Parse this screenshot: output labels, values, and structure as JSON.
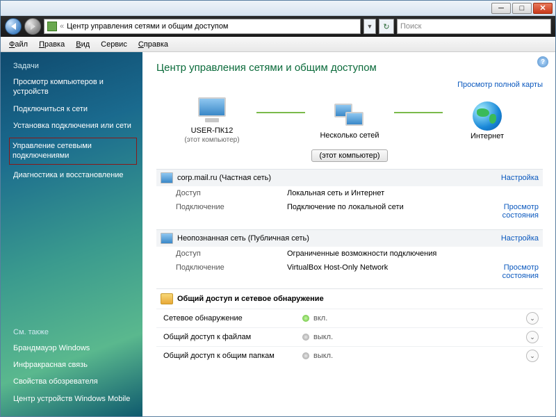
{
  "titlebar": {
    "minimize": "_",
    "maximize": "□",
    "close": "X"
  },
  "addressbar": {
    "crumb_prefix": "«",
    "crumb": "Центр управления сетями и общим доступом",
    "search_placeholder": "Поиск"
  },
  "menubar": {
    "file": "Файл",
    "edit": "Правка",
    "view": "Вид",
    "tools": "Сервис",
    "help": "Справка"
  },
  "sidebar": {
    "tasks_heading": "Задачи",
    "items": [
      "Просмотр компьютеров и устройств",
      "Подключиться к сети",
      "Установка подключения или сети",
      "Управление сетевыми подключениями",
      "Диагностика и восстановление"
    ],
    "see_also_heading": "См. также",
    "see_also": [
      "Брандмауэр Windows",
      "Инфракрасная связь",
      "Свойства обозревателя",
      "Центр устройств Windows Mobile"
    ]
  },
  "main": {
    "title": "Центр управления сетями и общим доступом",
    "full_map": "Просмотр полной карты",
    "map": {
      "pc_name": "USER-ПК12",
      "pc_sub": "(этот компьютер)",
      "multi": "Несколько сетей",
      "internet": "Интернет"
    },
    "this_computer_btn": "(этот компьютер)",
    "networks": [
      {
        "name": "corp.mail.ru (Частная сеть)",
        "customize": "Настройка",
        "access_label": "Доступ",
        "access_value": "Локальная сеть и Интернет",
        "conn_label": "Подключение",
        "conn_value": "Подключение по локальной сети",
        "view_status": "Просмотр состояния"
      },
      {
        "name": "Неопознанная сеть (Публичная сеть)",
        "customize": "Настройка",
        "access_label": "Доступ",
        "access_value": "Ограниченные возможности подключения",
        "conn_label": "Подключение",
        "conn_value": "VirtualBox Host-Only Network",
        "view_status": "Просмотр состояния"
      }
    ],
    "sharing": {
      "heading": "Общий доступ и сетевое обнаружение",
      "rows": [
        {
          "label": "Сетевое обнаружение",
          "state": "on",
          "state_text": "вкл."
        },
        {
          "label": "Общий доступ к файлам",
          "state": "off",
          "state_text": "выкл."
        },
        {
          "label": "Общий доступ к общим папкам",
          "state": "off",
          "state_text": "выкл."
        }
      ]
    }
  }
}
